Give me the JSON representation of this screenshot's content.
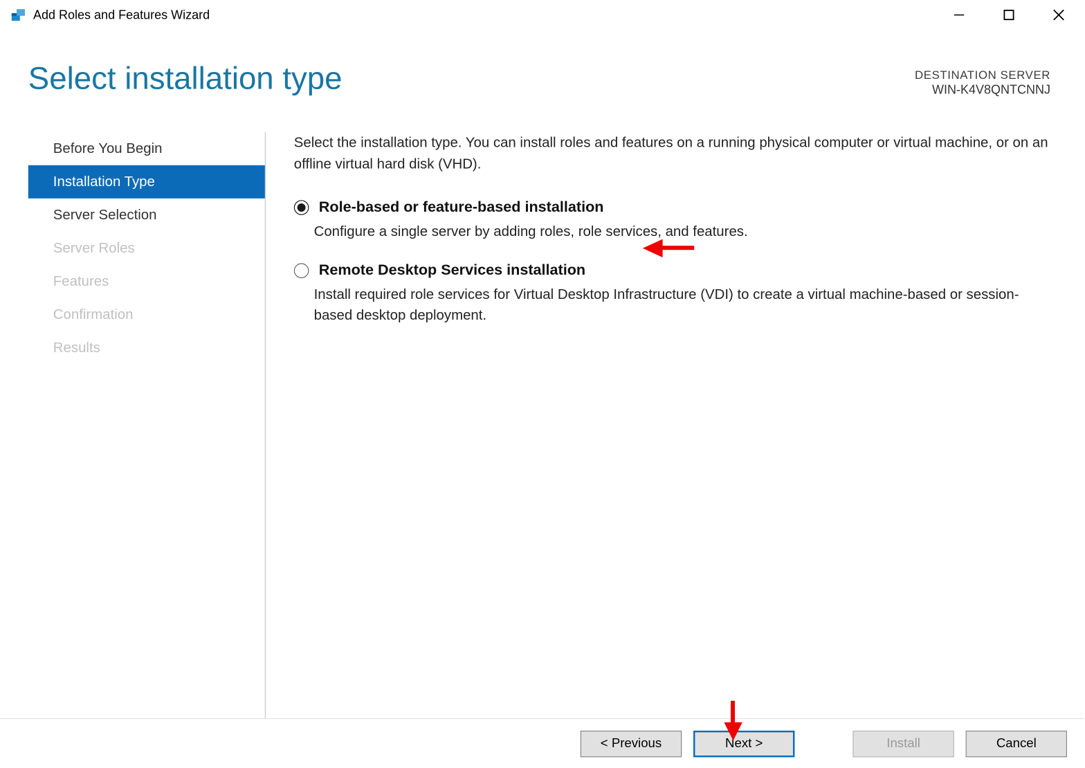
{
  "window": {
    "title": "Add Roles and Features Wizard"
  },
  "header": {
    "page_title": "Select installation type",
    "dest_label": "DESTINATION SERVER",
    "dest_server": "WIN-K4V8QNTCNNJ"
  },
  "sidebar": {
    "items": [
      {
        "label": "Before You Begin",
        "state": "normal"
      },
      {
        "label": "Installation Type",
        "state": "selected"
      },
      {
        "label": "Server Selection",
        "state": "normal"
      },
      {
        "label": "Server Roles",
        "state": "disabled"
      },
      {
        "label": "Features",
        "state": "disabled"
      },
      {
        "label": "Confirmation",
        "state": "disabled"
      },
      {
        "label": "Results",
        "state": "disabled"
      }
    ]
  },
  "content": {
    "intro": "Select the installation type. You can install roles and features on a running physical computer or virtual machine, or on an offline virtual hard disk (VHD).",
    "options": [
      {
        "label": "Role-based or feature-based installation",
        "description": "Configure a single server by adding roles, role services, and features.",
        "checked": true
      },
      {
        "label": "Remote Desktop Services installation",
        "description": "Install required role services for Virtual Desktop Infrastructure (VDI) to create a virtual machine-based or session-based desktop deployment.",
        "checked": false
      }
    ]
  },
  "footer": {
    "previous": "< Previous",
    "next": "Next >",
    "install": "Install",
    "cancel": "Cancel"
  }
}
